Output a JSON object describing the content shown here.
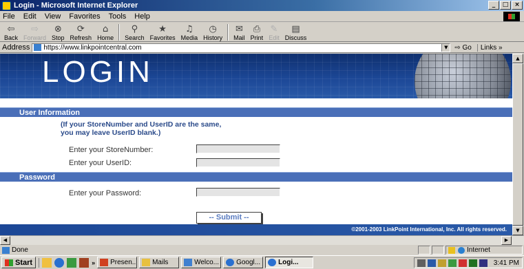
{
  "window": {
    "title": "Login - Microsoft Internet Explorer",
    "controls": {
      "minimize": "_",
      "maximize": "□",
      "close": "×"
    }
  },
  "menu": [
    "File",
    "Edit",
    "View",
    "Favorites",
    "Tools",
    "Help"
  ],
  "toolbar": {
    "back": {
      "label": "Back",
      "icon": "⇦"
    },
    "forward": {
      "label": "Forward",
      "icon": "⇨"
    },
    "stop": {
      "label": "Stop",
      "icon": "⊗"
    },
    "refresh": {
      "label": "Refresh",
      "icon": "⟳"
    },
    "home": {
      "label": "Home",
      "icon": "⌂"
    },
    "search": {
      "label": "Search",
      "icon": "⚲"
    },
    "favorites": {
      "label": "Favorites",
      "icon": "★"
    },
    "media": {
      "label": "Media",
      "icon": "♫"
    },
    "history": {
      "label": "History",
      "icon": "◷"
    },
    "mail": {
      "label": "Mail",
      "icon": "✉"
    },
    "print": {
      "label": "Print",
      "icon": "⎙"
    },
    "edit": {
      "label": "Edit",
      "icon": "✎"
    },
    "discuss": {
      "label": "Discuss",
      "icon": "▤"
    }
  },
  "address": {
    "label": "Address",
    "url": "https://www.linkpointcentral.com",
    "go_label": "Go",
    "links_label": "Links »"
  },
  "page": {
    "banner_title": "LOGIN",
    "user_section_title": "User Information",
    "note_line1": "(If your StoreNumber and UserID are the same,",
    "note_line2": "you may leave UserID blank.)",
    "store_label": "Enter your StoreNumber:",
    "userid_label": "Enter your UserID:",
    "password_section_title": "Password",
    "password_label": "Enter your Password:",
    "submit_label": "-- Submit --",
    "copyright": "©2001-2003 LinkPoint International, Inc. All rights reserved."
  },
  "status": {
    "text": "Done",
    "zone": "Internet"
  },
  "taskbar": {
    "start": "Start",
    "more": "»",
    "tasks": [
      "Presen...",
      "Mails",
      "Welco...",
      "Googl...",
      "Logi..."
    ],
    "active_task_index": 4,
    "clock": "3:41 PM"
  }
}
